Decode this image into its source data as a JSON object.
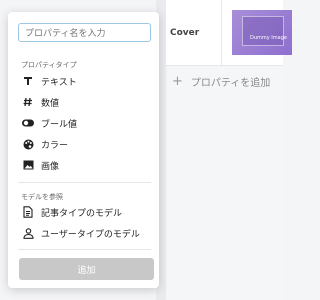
{
  "background": {
    "row_label": "Cover",
    "thumbnail_text": "Dummy Image",
    "add_property_label": "プロパティを追加"
  },
  "popup": {
    "search": {
      "placeholder": "プロパティ名を入力"
    },
    "property_types": {
      "title": "プロパティタイプ",
      "items": [
        {
          "label": "テキスト",
          "icon": "text-icon"
        },
        {
          "label": "数値",
          "icon": "hash-icon"
        },
        {
          "label": "ブール値",
          "icon": "toggle-icon"
        },
        {
          "label": "カラー",
          "icon": "palette-icon"
        },
        {
          "label": "画像",
          "icon": "image-icon"
        }
      ]
    },
    "references": {
      "title": "モデルを参照",
      "items": [
        {
          "label": "記事タイプのモデル",
          "icon": "document-icon"
        },
        {
          "label": "ユーザータイプのモデル",
          "icon": "user-icon"
        }
      ]
    },
    "add_button": "追加"
  },
  "colors": {
    "accent_border": "#9cc8e6",
    "disabled_button": "#c8c8c8",
    "thumbnail": "#9b7fd4"
  }
}
